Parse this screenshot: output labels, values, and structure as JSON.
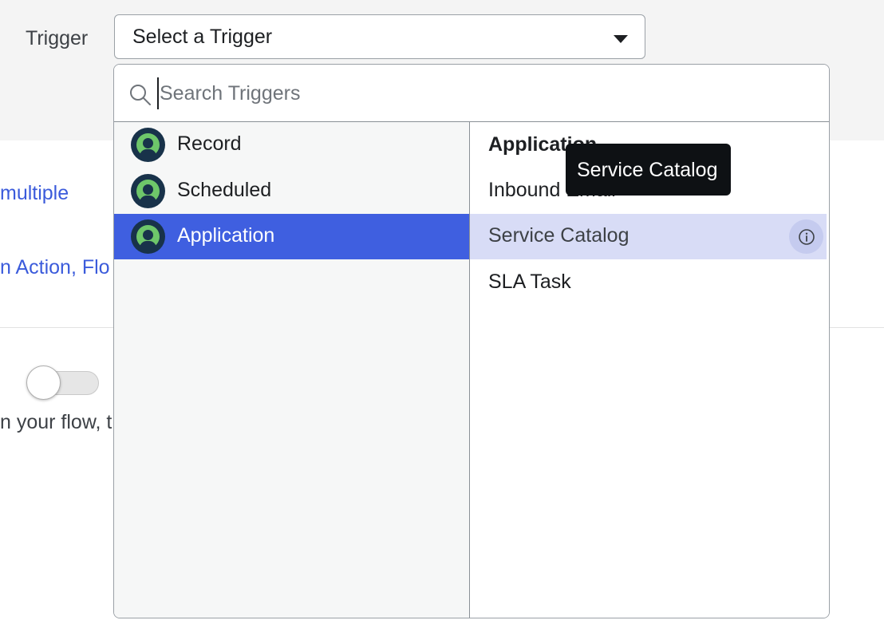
{
  "trigger": {
    "label": "Trigger",
    "selected_value": "Select a Trigger"
  },
  "background": {
    "link_text_1": "multiple",
    "link_text_2": "n Action, Flo",
    "body_text": "n your flow, t",
    "toggle_on": false
  },
  "search": {
    "placeholder": "Search Triggers",
    "value": ""
  },
  "categories": [
    {
      "label": "Record",
      "selected": false
    },
    {
      "label": "Scheduled",
      "selected": false
    },
    {
      "label": "Application",
      "selected": true
    }
  ],
  "trigger_list": {
    "heading": "Application",
    "items": [
      {
        "label": "Inbound Email",
        "hovered": false
      },
      {
        "label": "Service Catalog",
        "hovered": true
      },
      {
        "label": "SLA Task",
        "hovered": false
      }
    ]
  },
  "tooltip": {
    "text": "Service Catalog"
  },
  "colors": {
    "selected_bg": "#3f5fe0",
    "hover_bg": "#d8dcf6",
    "link": "#3b5bdb",
    "icon_green": "#6ec66a",
    "icon_navy": "#18324a"
  },
  "icons": {
    "search": "search-icon",
    "dropdown": "chevron-down-icon",
    "category": "application-logo-icon",
    "info": "info-icon"
  }
}
